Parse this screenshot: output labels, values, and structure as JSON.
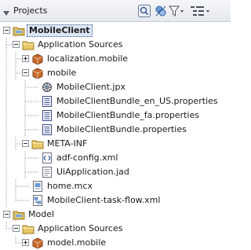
{
  "panel": {
    "title": "Projects",
    "toolbar": [
      {
        "icon": "navigator-icon"
      },
      {
        "icon": "working-sets-icon"
      },
      {
        "icon": "filter-icon"
      },
      {
        "icon": "view-options-icon"
      }
    ]
  },
  "tree": {
    "items": [
      {
        "label": "MobileClient",
        "icon": "project-folder-icon",
        "expanded": true,
        "selected": true
      },
      {
        "label": "Application Sources",
        "icon": "folder-icon",
        "expanded": true
      },
      {
        "label": "localization.mobile",
        "icon": "package-icon",
        "expanded": false
      },
      {
        "label": "mobile",
        "icon": "package-icon",
        "expanded": true
      },
      {
        "label": "MobileClient.jpx",
        "icon": "jpx-file-icon"
      },
      {
        "label": "MobileClientBundle_en_US.properties",
        "icon": "properties-file-icon"
      },
      {
        "label": "MobileClientBundle_fa.properties",
        "icon": "properties-file-icon"
      },
      {
        "label": "MobileClientBundle.properties",
        "icon": "properties-file-icon"
      },
      {
        "label": "META-INF",
        "icon": "folder-icon",
        "expanded": true
      },
      {
        "label": "adf-config.xml",
        "icon": "xml-file-icon"
      },
      {
        "label": "UiApplication.jad",
        "icon": "jad-file-icon"
      },
      {
        "label": "home.mcx",
        "icon": "mcx-file-icon"
      },
      {
        "label": "MobileClient-task-flow.xml",
        "icon": "task-flow-file-icon"
      },
      {
        "label": "Model",
        "icon": "project-folder-icon",
        "expanded": true
      },
      {
        "label": "Application Sources",
        "icon": "folder-icon",
        "expanded": true
      },
      {
        "label": "model.mobile",
        "icon": "package-icon",
        "expanded": false
      }
    ]
  },
  "colors": {
    "selection_bg": "#dde6f4",
    "folder": "#e8c868",
    "package": "#c96a2c",
    "header_bg": "#eceff3"
  }
}
